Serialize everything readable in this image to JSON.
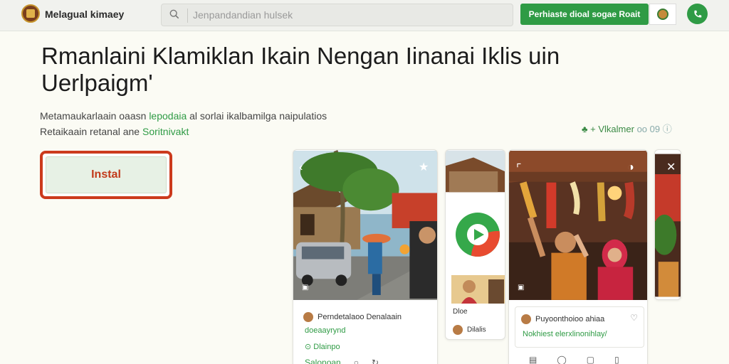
{
  "header": {
    "brand": "Melagual kimaey",
    "search_placeholder": "Jenpandandian hulsek",
    "promo_button": "Perhiaste dioal sogae Roait"
  },
  "hero": {
    "headline": "Rmanlaini Klamiklan Ikain Nengan Iinanai Iklis uin Uerlpaigm'",
    "sub_line1_a": "Metamaukarlaain oaasn",
    "sub_line1_b": "lepodaia",
    "sub_line1_c": "al sorlai ikalbamilga naipulatios",
    "sub_line2_a": "Retaikaain retanal ane",
    "sub_line2_b": "Soritnivakt",
    "rating_text": "+ Vlkalmer",
    "rating_count": "oo 09",
    "install_label": "Instal"
  },
  "cards": {
    "card1": {
      "author": "Perndetalaoo Denalaain",
      "tag": "doeaayrynd",
      "chip": "Dlainpo",
      "action": "Salonoan"
    },
    "card2": {
      "label1": "Dloe",
      "label2": "Dilalis"
    },
    "card3": {
      "author": "Puyoonthoioo ahiaa",
      "tag": "Nokhiest elerxlinonihlay/"
    }
  },
  "colors": {
    "accent": "#2f9b45",
    "install_border": "#cc3a1c"
  }
}
